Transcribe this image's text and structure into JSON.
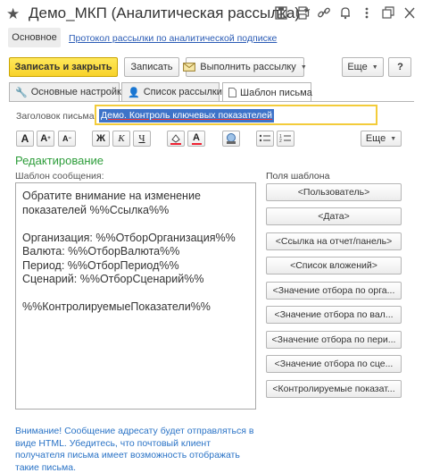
{
  "window": {
    "title": "Демо_МКП (Аналитическая рассылка) *",
    "icons": [
      "star-icon",
      "save-icon",
      "print-icon",
      "link-icon",
      "bell-icon",
      "more-icon",
      "restore-icon",
      "close-icon"
    ]
  },
  "nav": {
    "main": "Основное",
    "link": "Протокол рассылки по аналитической подписке"
  },
  "toolbar": {
    "save_close": "Записать и закрыть",
    "save": "Записать",
    "run": "Выполнить рассылку",
    "more": "Еще"
  },
  "tabs": [
    {
      "label": "Основные настройки",
      "icon": "wrench-icon"
    },
    {
      "label": "Список рассылки",
      "icon": "users-icon"
    },
    {
      "label": "Шаблон письма",
      "icon": "document-icon"
    }
  ],
  "subject": {
    "label": "Заголовок письма:",
    "value": "Демо. Контроль ключевых показателей"
  },
  "format": {
    "more": "Еще",
    "buttons": [
      "A",
      "A",
      "A",
      "Ж",
      "К",
      "Ч"
    ]
  },
  "editing": {
    "section_title": "Редактирование",
    "message_label": "Шаблон сообщения:",
    "lines": [
      "Обратите внимание на изменение",
      "показателей %%Ссылка%%",
      "",
      "Организация: %%ОтборОрганизация%%",
      "Валюта: %%ОтборВалюта%%",
      "Период: %%ОтборПериод%%",
      "Сценарий: %%ОтборСценарий%%",
      "",
      "%%КонтролируемыеПоказатели%%"
    ]
  },
  "fields": {
    "title": "Поля шаблона",
    "buttons": [
      "<Пользователь>",
      "<Дата>",
      "<Ссылка на отчет/панель>",
      "<Список вложений>",
      "<Значение отбора по орга...",
      "<Значение отбора по вал...",
      "<Значение отбора по пери...",
      "<Значение отбора по сце...",
      "<Контролируемые показат..."
    ]
  },
  "notice": "Внимание! Сообщение адресату будет отправляться в виде HTML. Убедитесь, что почтовый клиент получателя письма имеет возможность отображать такие письма.",
  "colors": {
    "accent_yellow": "#f8d22a",
    "link_blue": "#2a5bb5",
    "section_green": "#2d9d3a",
    "selection_blue": "#3d73c9",
    "focus_border": "#f3cc3a"
  }
}
